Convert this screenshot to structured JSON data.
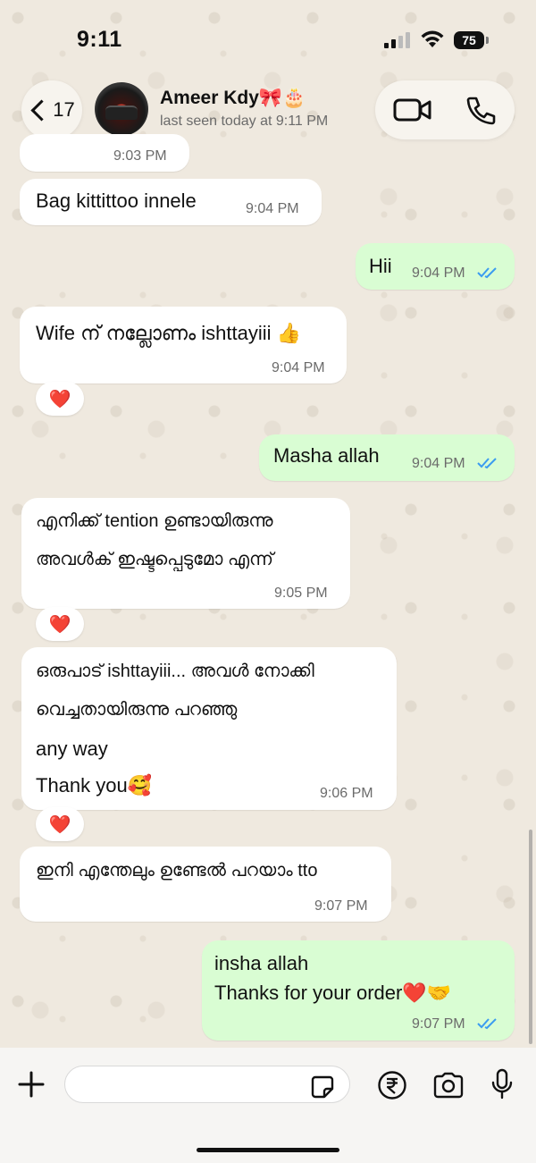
{
  "status_bar": {
    "time": "9:11",
    "battery": "75"
  },
  "header": {
    "back_count": "17",
    "contact_name": "Ameer Kdy🎀🎂",
    "last_seen": "last seen today at 9:11 PM"
  },
  "messages": [
    {
      "dir": "in",
      "lines": [],
      "time": "9:03 PM"
    },
    {
      "dir": "in",
      "lines": [
        "Bag kittittoo innele"
      ],
      "time": "9:04 PM"
    },
    {
      "dir": "out",
      "lines": [
        "Hii"
      ],
      "time": "9:04 PM",
      "status": "read"
    },
    {
      "dir": "in",
      "lines": [
        "Wife ന് നല്ലോണം ishttayiii 👍"
      ],
      "time": "9:04 PM",
      "reaction": "❤️"
    },
    {
      "dir": "out",
      "lines": [
        "Masha allah"
      ],
      "time": "9:04 PM",
      "status": "read"
    },
    {
      "dir": "in",
      "lines": [
        "എനിക്ക് tention ഉണ്ടായിരുന്നു",
        "അവൾക് ഇഷ്ടപ്പെടുമോ എന്ന്"
      ],
      "time": "9:05 PM",
      "reaction": "❤️"
    },
    {
      "dir": "in",
      "lines": [
        "ഒരുപാട് ishttayiii... അവൾ നോക്കി",
        "വെച്ചതായിരുന്നു പറഞ്ഞു",
        "any way",
        "Thank you🥰"
      ],
      "time": "9:06 PM",
      "reaction": "❤️"
    },
    {
      "dir": "in",
      "lines": [
        "ഇനി എന്തേലും ഉണ്ടേൽ പറയാം tto"
      ],
      "time": "9:07 PM"
    },
    {
      "dir": "out",
      "lines": [
        "insha allah",
        "Thanks for your order❤️🤝"
      ],
      "time": "9:07 PM",
      "status": "read"
    }
  ],
  "composer": {
    "placeholder": ""
  },
  "colors": {
    "incoming": "#ffffff",
    "outgoing": "#d9fdd3",
    "read_tick": "#3b9cf0",
    "heart": "#e0182d"
  },
  "icons": [
    "chevron-left-icon",
    "video-call-icon",
    "phone-icon",
    "plus-icon",
    "sticker-icon",
    "rupee-icon",
    "camera-icon",
    "microphone-icon"
  ]
}
